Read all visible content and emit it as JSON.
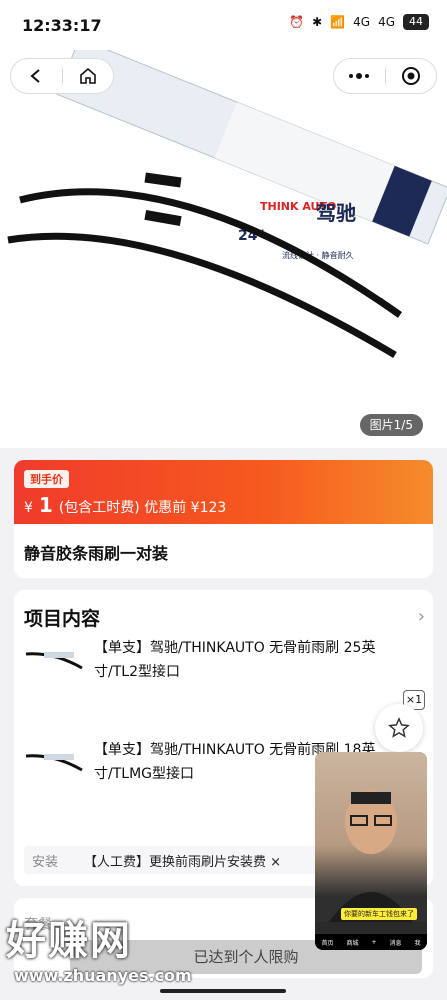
{
  "status": {
    "time": "12:33:17",
    "battery": "44",
    "network_1": "4G",
    "network_2": "4G"
  },
  "gallery": {
    "counter": "图片1/5",
    "image_brand": "THINK AUTO",
    "image_brand_cn": "驾驰",
    "image_size": "24\"",
    "image_tagline": "流线设计 · 静音耐久"
  },
  "price": {
    "tag": "到手价",
    "currency": "¥",
    "amount": "1",
    "note": "(包含工时费) 优惠前 ¥123"
  },
  "product": {
    "title": "静音胶条雨刷一对装"
  },
  "items_section": {
    "title": "项目内容",
    "items": [
      {
        "name": "【单支】驾驰/THINKAUTO 无骨前雨刷 25英寸/TL2型接口"
      },
      {
        "name": "【单支】驾驰/THINKAUTO 无骨前雨刷 18英寸/TLMG型接口"
      }
    ],
    "qty_badge": "×1",
    "install_label": "安装",
    "install_value": "【人工费】更换前雨刷片安装费 ×"
  },
  "bottom": {
    "partial_text": "套餐"
  },
  "limit_banner": "已达到个人限购",
  "video": {
    "caption": "你要的新车工钱包来了",
    "tabs": [
      "首页",
      "商城",
      "+",
      "消息",
      "我"
    ]
  },
  "watermark": {
    "text": "好赚网",
    "url": "www.zhuanyes.com"
  },
  "colors": {
    "accent_red": "#f03b2c",
    "accent_orange": "#f58c2c"
  }
}
